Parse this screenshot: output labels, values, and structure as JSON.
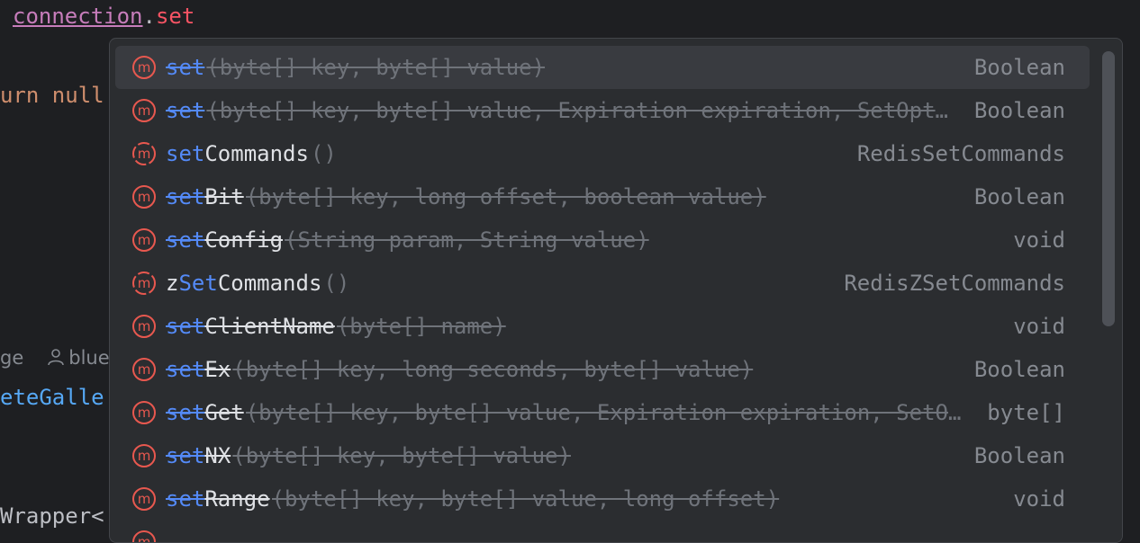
{
  "editor": {
    "line1": {
      "object": "connection",
      "dot": ".",
      "typed": "set"
    },
    "line2": {
      "text": "urn null"
    },
    "line3": {
      "usages": "ge",
      "author": "bluet"
    },
    "line4": {
      "text": "eteGalle"
    },
    "line5": {
      "text": "Wrapper<"
    }
  },
  "colors": {
    "background": "#1e1f22",
    "popup_bg": "#2b2d30",
    "selected_row": "#393b40",
    "method_icon": "#e8584f",
    "match_highlight": "#548af7"
  },
  "completion": {
    "items": [
      {
        "icon": "method-icon",
        "match": "set",
        "rest": "",
        "params": "(byte[] key, byte[] value)",
        "type": "Boolean",
        "deprecated": true,
        "selected": true
      },
      {
        "icon": "method-icon",
        "match": "set",
        "rest": "",
        "params": "(byte[] key, byte[] value, Expiration expiration, SetOption option)",
        "type": "Boolean",
        "deprecated": true,
        "selected": false
      },
      {
        "icon": "method-abstract-icon",
        "match": "set",
        "rest": "Commands",
        "params": "()",
        "type": "RedisSetCommands",
        "deprecated": false,
        "selected": false
      },
      {
        "icon": "method-icon",
        "match": "set",
        "rest": "Bit",
        "params": "(byte[] key, long offset, boolean value)",
        "type": "Boolean",
        "deprecated": true,
        "selected": false
      },
      {
        "icon": "method-icon",
        "match": "set",
        "rest": "Config",
        "params": "(String param, String value)",
        "type": "void",
        "deprecated": true,
        "selected": false
      },
      {
        "icon": "method-abstract-icon",
        "pre": "z",
        "match": "Set",
        "rest": "Commands",
        "params": "()",
        "type": "RedisZSetCommands",
        "deprecated": false,
        "selected": false
      },
      {
        "icon": "method-icon",
        "match": "set",
        "rest": "ClientName",
        "params": "(byte[] name)",
        "type": "void",
        "deprecated": true,
        "selected": false
      },
      {
        "icon": "method-icon",
        "match": "set",
        "rest": "Ex",
        "params": "(byte[] key, long seconds, byte[] value)",
        "type": "Boolean",
        "deprecated": true,
        "selected": false
      },
      {
        "icon": "method-icon",
        "match": "set",
        "rest": "Get",
        "params": "(byte[] key, byte[] value, Expiration expiration, SetOption option)",
        "type": "byte[]",
        "deprecated": true,
        "selected": false
      },
      {
        "icon": "method-icon",
        "match": "set",
        "rest": "NX",
        "params": "(byte[] key, byte[] value)",
        "type": "Boolean",
        "deprecated": true,
        "selected": false
      },
      {
        "icon": "method-icon",
        "match": "set",
        "rest": "Range",
        "params": "(byte[] key, byte[] value, long offset)",
        "type": "void",
        "deprecated": true,
        "selected": false
      },
      {
        "icon": "method-icon",
        "match": "",
        "rest": "",
        "params": "",
        "type": "",
        "deprecated": true,
        "selected": false
      }
    ]
  }
}
